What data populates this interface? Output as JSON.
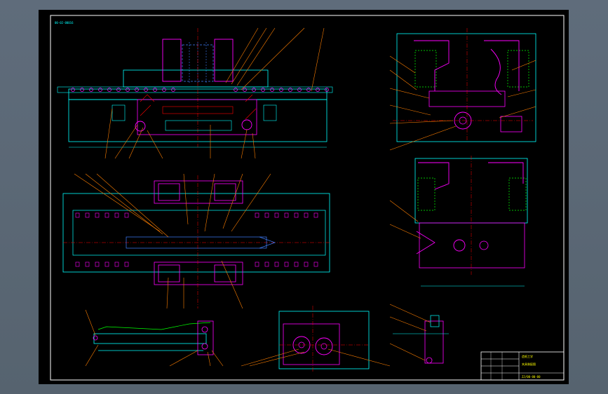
{
  "drawing": {
    "code_tag": "00-02-00016",
    "title_block": {
      "name_line1": "造纸工学",
      "name_line2": "夹具装配图",
      "drawing_no": "ZJ/00-00-00"
    }
  },
  "colors": {
    "background": "#000000",
    "border": "#ffffff",
    "outline_cyan": "#00ffff",
    "part_magenta": "#ff00ff",
    "leader_orange": "#ff7f00",
    "hatch_red": "#ff0000",
    "text_yellow": "#ffff00",
    "center_blue": "#3f7fff",
    "green": "#00ff00"
  }
}
